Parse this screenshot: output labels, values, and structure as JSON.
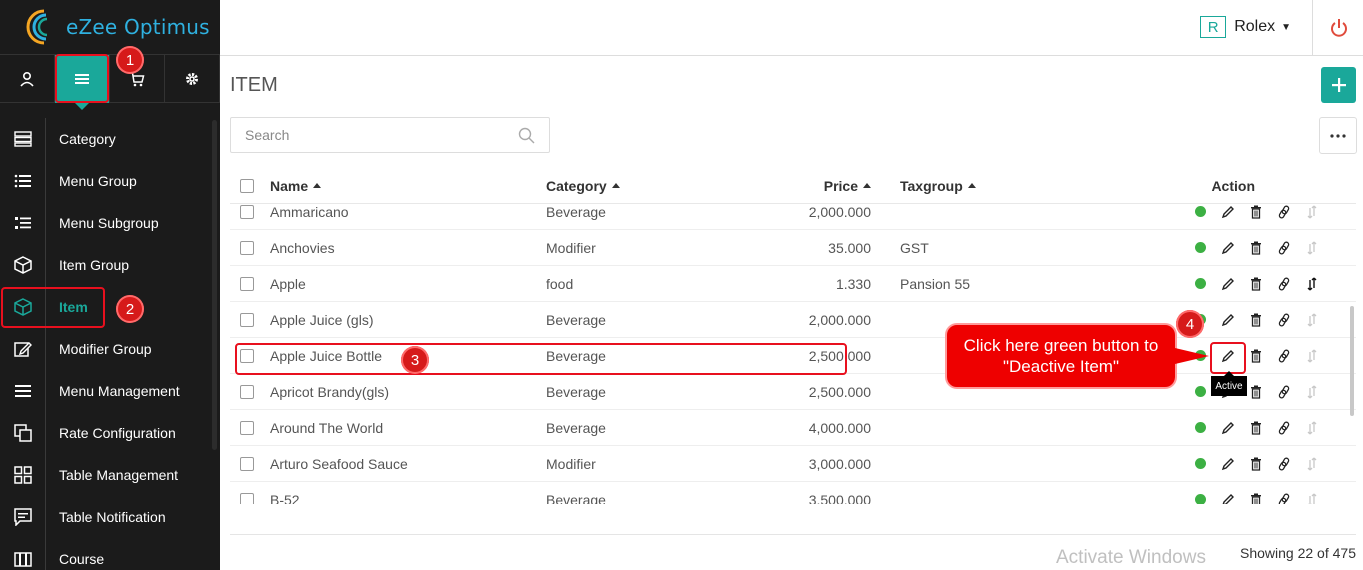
{
  "app": {
    "logo_text": "eZee Optimus",
    "brand_color": "#1aa89a"
  },
  "header": {
    "user_initial": "R",
    "user_name": "Rolex"
  },
  "topnav": [
    {
      "icon": "user-icon"
    },
    {
      "icon": "menu-lines-icon",
      "active": true
    },
    {
      "icon": "cart-icon"
    },
    {
      "icon": "gear-icon"
    }
  ],
  "sidebar": {
    "items": [
      {
        "label": "Category",
        "icon": "category-list-icon"
      },
      {
        "label": "Menu Group",
        "icon": "bulleted-list-icon"
      },
      {
        "label": "Menu Subgroup",
        "icon": "sublist-icon"
      },
      {
        "label": "Item Group",
        "icon": "box-icon"
      },
      {
        "label": "Item",
        "icon": "cube-icon",
        "active": true
      },
      {
        "label": "Modifier Group",
        "icon": "edit-box-icon"
      },
      {
        "label": "Menu Management",
        "icon": "hamburger-icon"
      },
      {
        "label": "Rate Configuration",
        "icon": "copy-icon"
      },
      {
        "label": "Table Management",
        "icon": "grid-icon"
      },
      {
        "label": "Table Notification",
        "icon": "chat-icon"
      },
      {
        "label": "Course",
        "icon": "course-icon"
      }
    ]
  },
  "main": {
    "title": "ITEM",
    "search_placeholder": "Search",
    "columns": {
      "name": "Name",
      "category": "Category",
      "price": "Price",
      "taxgroup": "Taxgroup",
      "action": "Action"
    },
    "rows": [
      {
        "name": "Ammaricano",
        "category": "Beverage",
        "price": "2,000.000",
        "taxgroup": ""
      },
      {
        "name": "Anchovies",
        "category": "Modifier",
        "price": "35.000",
        "taxgroup": "GST"
      },
      {
        "name": "Apple",
        "category": "food",
        "price": "1.330",
        "taxgroup": "Pansion 55"
      },
      {
        "name": "Apple Juice (gls)",
        "category": "Beverage",
        "price": "2,000.000",
        "taxgroup": ""
      },
      {
        "name": "Apple Juice Bottle",
        "category": "Beverage",
        "price": "2,500.000",
        "taxgroup": ""
      },
      {
        "name": "Apricot Brandy(gls)",
        "category": "Beverage",
        "price": "2,500.000",
        "taxgroup": ""
      },
      {
        "name": "Around The World",
        "category": "Beverage",
        "price": "4,000.000",
        "taxgroup": ""
      },
      {
        "name": "Arturo Seafood Sauce",
        "category": "Modifier",
        "price": "3,000.000",
        "taxgroup": ""
      },
      {
        "name": "B-52",
        "category": "Beverage",
        "price": "3,500.000",
        "taxgroup": ""
      }
    ],
    "showing": "Showing 22 of 475",
    "tooltip": "Active"
  },
  "annotations": {
    "markers": [
      "1",
      "2",
      "3",
      "4"
    ],
    "callout": "Click here green button to \"Deactive Item\""
  },
  "watermark": "Activate Windows"
}
